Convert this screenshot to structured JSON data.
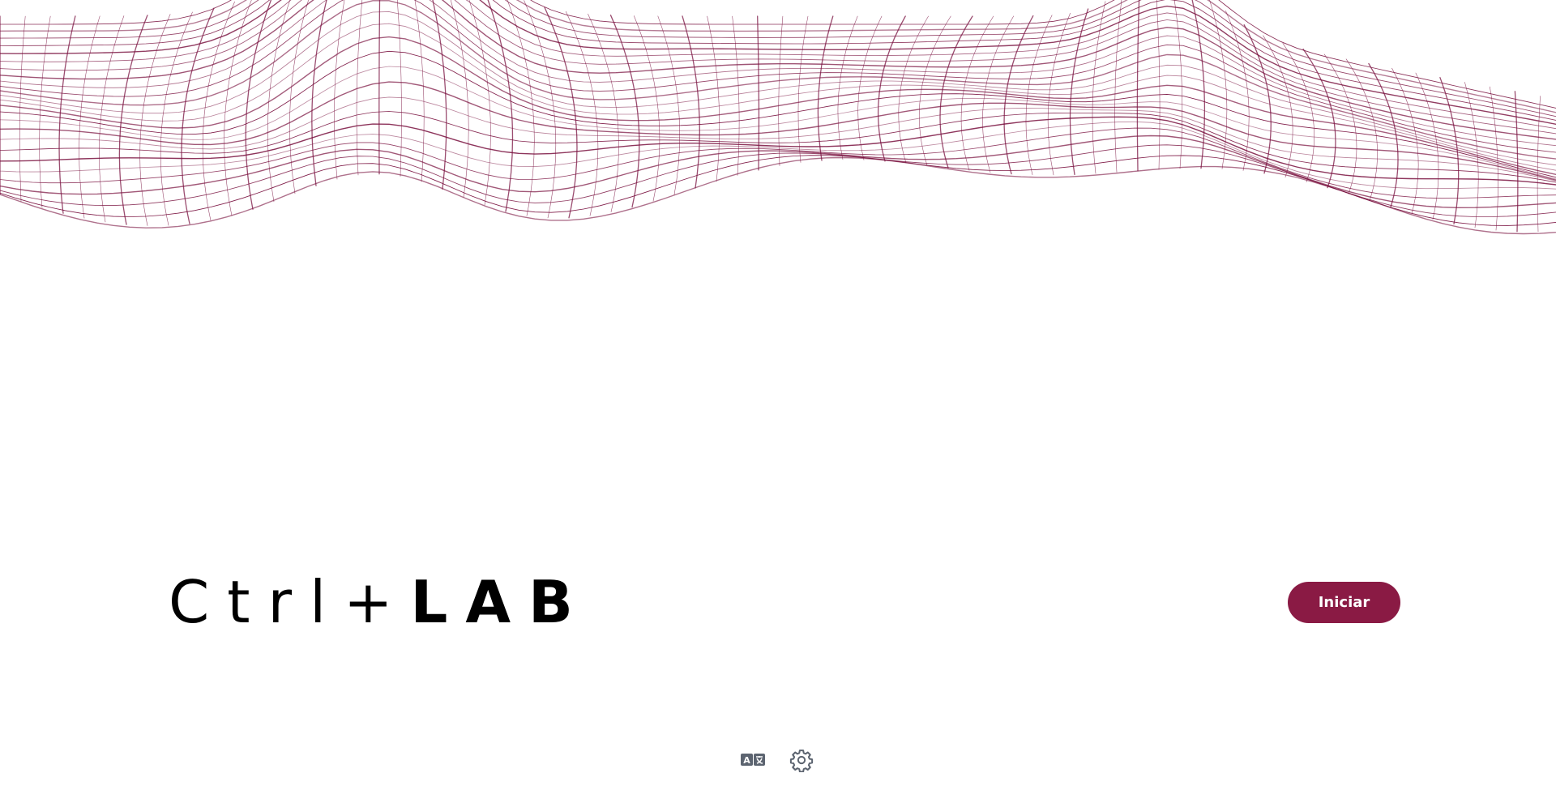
{
  "logo": {
    "light_text": "Ctrl+",
    "bold_text": "LAB"
  },
  "start_button": {
    "label": "Iniciar"
  },
  "footer": {
    "icons": [
      "translate-icon",
      "gear-icon"
    ]
  },
  "colors": {
    "accent": "#8a1a44",
    "wave": "#7a1240",
    "icon": "#5c6470",
    "background": "#ffffff"
  }
}
